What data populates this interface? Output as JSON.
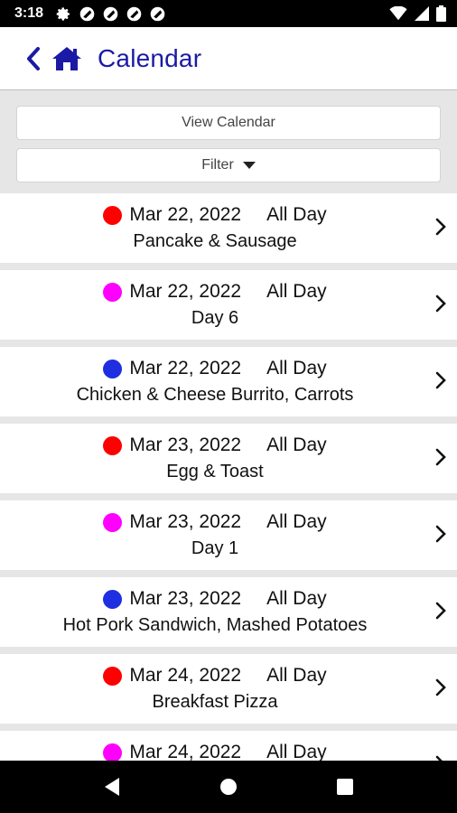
{
  "status": {
    "time": "3:18"
  },
  "header": {
    "title": "Calendar"
  },
  "controls": {
    "view_calendar": "View Calendar",
    "filter": "Filter"
  },
  "colors": {
    "accent": "#1a1aa6",
    "red": "#ff0000",
    "magenta": "#ff00ff",
    "blue": "#1f2ee0"
  },
  "events": [
    {
      "color": "#ff0000",
      "date": "Mar 22, 2022",
      "time": "All Day",
      "title": "Pancake & Sausage"
    },
    {
      "color": "#ff00ff",
      "date": "Mar 22, 2022",
      "time": "All Day",
      "title": "Day 6"
    },
    {
      "color": "#1f2ee0",
      "date": "Mar 22, 2022",
      "time": "All Day",
      "title": "Chicken & Cheese Burrito, Carrots"
    },
    {
      "color": "#ff0000",
      "date": "Mar 23, 2022",
      "time": "All Day",
      "title": "Egg & Toast"
    },
    {
      "color": "#ff00ff",
      "date": "Mar 23, 2022",
      "time": "All Day",
      "title": "Day 1"
    },
    {
      "color": "#1f2ee0",
      "date": "Mar 23, 2022",
      "time": "All Day",
      "title": "Hot Pork Sandwich, Mashed Potatoes"
    },
    {
      "color": "#ff0000",
      "date": "Mar 24, 2022",
      "time": "All Day",
      "title": "Breakfast Pizza"
    },
    {
      "color": "#ff00ff",
      "date": "Mar 24, 2022",
      "time": "All Day",
      "title": ""
    }
  ]
}
